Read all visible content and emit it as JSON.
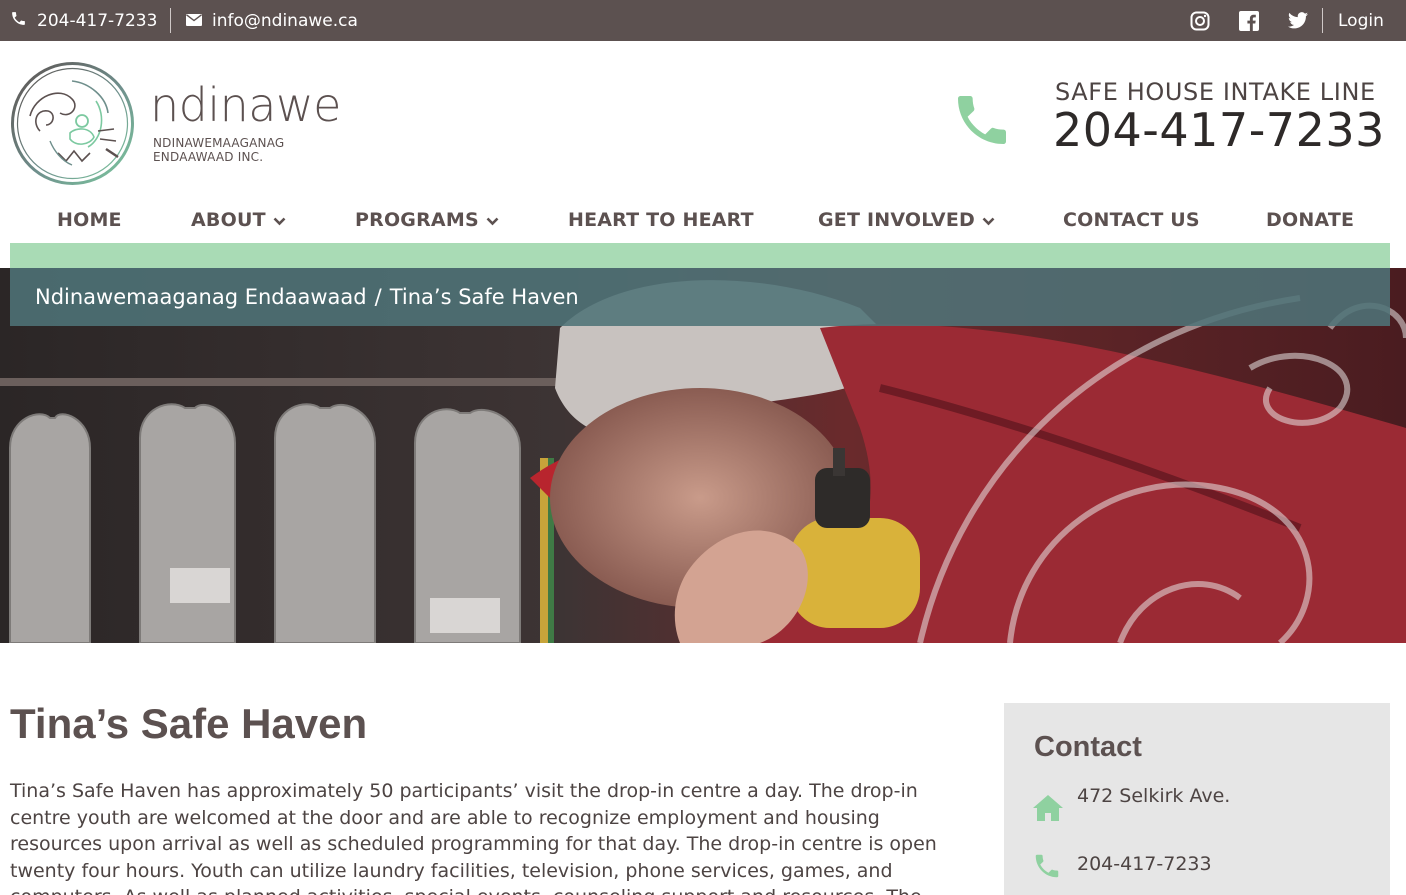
{
  "topbar": {
    "phone": "204-417-7233",
    "email": "info@ndinawe.ca",
    "login": "Login",
    "icons": [
      "phone-icon",
      "mail-icon",
      "instagram-icon",
      "facebook-icon",
      "twitter-icon"
    ]
  },
  "brand": {
    "name": "ndinawe",
    "sub_line1": "NDINAWEMAAGANAG",
    "sub_line2": "ENDAAWAAD  INC."
  },
  "intake": {
    "label": "SAFE HOUSE INTAKE LINE",
    "number": "204-417-7233"
  },
  "nav": {
    "items": [
      {
        "label": "HOME",
        "dropdown": false
      },
      {
        "label": "ABOUT",
        "dropdown": true
      },
      {
        "label": "PROGRAMS",
        "dropdown": true
      },
      {
        "label": "HEART TO HEART",
        "dropdown": false
      },
      {
        "label": "GET INVOLVED",
        "dropdown": true
      },
      {
        "label": "CONTACT US",
        "dropdown": false
      },
      {
        "label": "DONATE",
        "dropdown": false
      }
    ]
  },
  "breadcrumb": {
    "parent": "Ndinawemaaganag Endaawaad",
    "separator": "/",
    "current": "Tina’s Safe Haven"
  },
  "main": {
    "title": "Tina’s Safe Haven",
    "body_lines": [
      "Tina’s Safe Haven has approximately 50 participants’ visit the drop-in centre a day. The drop-in",
      "centre youth are welcomed at the door and are able to recognize employment and housing",
      "resources upon arrival as well as scheduled programming for that day. The drop-in centre is open",
      "twenty four hours. Youth can utilize laundry facilities, television, phone services, games, and",
      "computers. As well as planned activities, special events, counseling support and resources. The"
    ]
  },
  "sidebar": {
    "title": "Contact",
    "address": "472 Selkirk Ave.",
    "phone": "204-417-7233"
  },
  "colors": {
    "topbar_bg": "#5c5150",
    "accent_green": "#a9dbb5",
    "icon_green": "#8fd1a0",
    "breadcrumb_bg": "#4f7378",
    "heading": "#5c5150",
    "sidebar_bg": "#e6e6e6"
  }
}
